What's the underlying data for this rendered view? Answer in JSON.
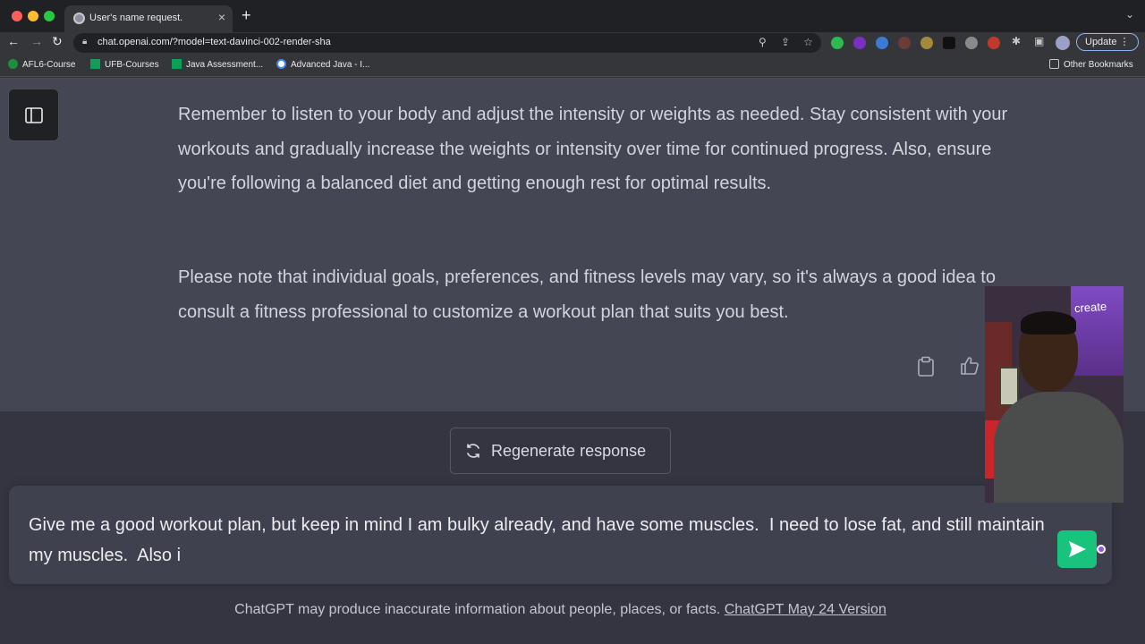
{
  "browser": {
    "tab_title": "User's name request.",
    "url": "chat.openai.com/?model=text-davinci-002-render-sha",
    "update_label": "Update",
    "bookmarks": [
      {
        "label": "AFL6-Course",
        "icon": "green-circle-icon"
      },
      {
        "label": "UFB-Courses",
        "icon": "sheets-icon"
      },
      {
        "label": "Java Assessment...",
        "icon": "sheets-icon"
      },
      {
        "label": "Advanced Java - I...",
        "icon": "google-icon"
      }
    ],
    "other_bookmarks": "Other Bookmarks"
  },
  "conversation": {
    "paragraphs": [
      "Remember to listen to your body and adjust the intensity or weights as needed. Stay consistent with your workouts and gradually increase the weights or intensity over time for continued progress. Also, ensure you're following a balanced diet and getting enough rest for optimal results.",
      "Please note that individual goals, preferences, and fitness levels may vary, so it's always a good idea to consult a fitness professional to customize a workout plan that suits you best."
    ]
  },
  "regenerate": {
    "label": "Regenerate response"
  },
  "composer": {
    "value": "Give me a good workout plan, but keep in mind I am bulky already, and have some muscles.  I need to lose fat, and still maintain my muscles.  Also i"
  },
  "footer": {
    "disclaimer": "ChatGPT may produce inaccurate information about people, places, or facts.",
    "version_link": "ChatGPT May 24 Version"
  },
  "webcam": {
    "badge": "create"
  },
  "colors": {
    "send_button": "#19c37d",
    "page_bg": "#444654",
    "composer_bg": "#40414f"
  }
}
